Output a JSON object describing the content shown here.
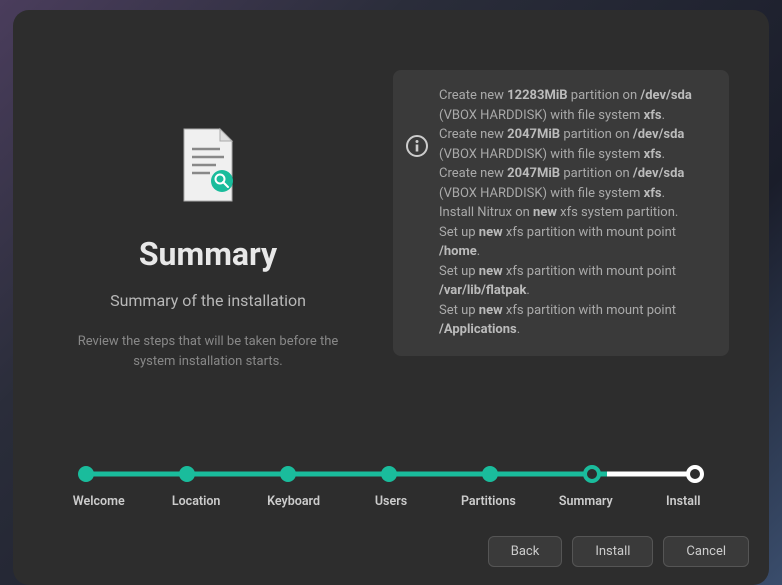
{
  "left": {
    "title": "Summary",
    "subtitle": "Summary of the installation",
    "description": "Review the steps that will be taken before the system installation starts."
  },
  "summary": {
    "lines": [
      {
        "prefix": "Create new ",
        "b1": "12283MiB",
        "mid": " partition on ",
        "b2": "/dev/sda",
        "mid2": " (VBOX HARDDISK) with file system ",
        "b3": "xfs",
        "suffix": "."
      },
      {
        "prefix": "Create new ",
        "b1": "2047MiB",
        "mid": " partition on ",
        "b2": "/dev/sda",
        "mid2": " (VBOX HARDDISK) with file system ",
        "b3": "xfs",
        "suffix": "."
      },
      {
        "prefix": "Create new ",
        "b1": "2047MiB",
        "mid": " partition on ",
        "b2": "/dev/sda",
        "mid2": " (VBOX HARDDISK) with file system ",
        "b3": "xfs",
        "suffix": "."
      },
      {
        "prefix": "Install Nitrux on ",
        "b1": "new",
        "mid": " xfs system partition.",
        "b2": "",
        "mid2": "",
        "b3": "",
        "suffix": ""
      },
      {
        "prefix": "Set up ",
        "b1": "new",
        "mid": " xfs partition with mount point ",
        "b2": "/home",
        "mid2": "",
        "b3": "",
        "suffix": "."
      },
      {
        "prefix": "Set up ",
        "b1": "new",
        "mid": " xfs partition with mount point ",
        "b2": "/var/lib/flatpak",
        "mid2": "",
        "b3": "",
        "suffix": "."
      },
      {
        "prefix": "Set up ",
        "b1": "new",
        "mid": " xfs partition with mount point ",
        "b2": "/Applications",
        "mid2": "",
        "b3": "",
        "suffix": "."
      }
    ]
  },
  "steps": [
    "Welcome",
    "Location",
    "Keyboard",
    "Users",
    "Partitions",
    "Summary",
    "Install"
  ],
  "buttons": {
    "back": "Back",
    "install": "Install",
    "cancel": "Cancel"
  }
}
